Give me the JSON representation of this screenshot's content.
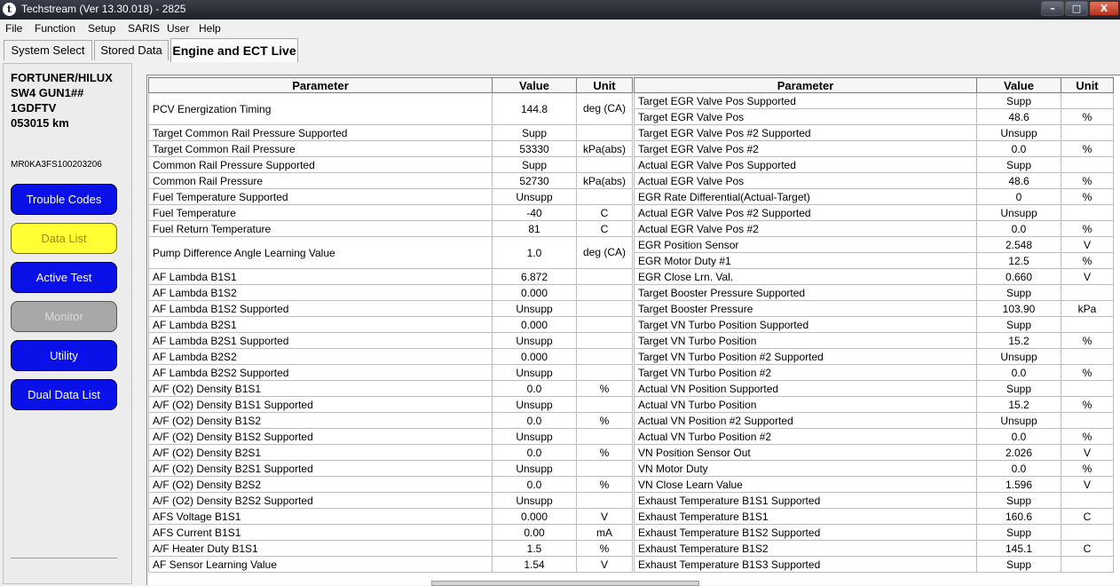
{
  "window": {
    "title": "Techstream (Ver 13.30.018) - 2825",
    "icon_name": "techstream-app-icon",
    "controls": {
      "minimize": "–",
      "maximize": "□",
      "close": "X"
    }
  },
  "menu": [
    "File",
    "Function",
    "Setup",
    "SARIS",
    "User",
    "Help"
  ],
  "tabs": [
    {
      "label": "System Select",
      "active": false
    },
    {
      "label": "Stored Data",
      "active": false
    },
    {
      "label": "Engine and ECT Live",
      "active": true
    }
  ],
  "vehicle": {
    "model_line1": "FORTUNER/HILUX",
    "model_line2": "SW4 GUN1##",
    "engine": "1GDFTV",
    "odometer": "053015 km",
    "vin": "MR0KA3FS100203206"
  },
  "nav_buttons": [
    {
      "label": "Trouble Codes",
      "state": "normal"
    },
    {
      "label": "Data List",
      "state": "selected"
    },
    {
      "label": "Active Test",
      "state": "normal"
    },
    {
      "label": "Monitor",
      "state": "disabled"
    },
    {
      "label": "Utility",
      "state": "normal"
    },
    {
      "label": "Dual Data List",
      "state": "normal"
    }
  ],
  "colors": {
    "nav_blue": "#0a10e8",
    "nav_selected": "#ffff33",
    "nav_disabled": "#a8a8a8"
  },
  "table": {
    "headers": [
      "Parameter",
      "Value",
      "Unit"
    ],
    "left_rows": [
      {
        "p": "PCV Energization Timing",
        "v": "144.8",
        "u": "deg (CA)",
        "tall": true
      },
      {
        "p": "Target Common Rail Pressure Supported",
        "v": "Supp",
        "u": ""
      },
      {
        "p": "Target Common Rail Pressure",
        "v": "53330",
        "u": "kPa(abs)"
      },
      {
        "p": "Common Rail Pressure Supported",
        "v": "Supp",
        "u": ""
      },
      {
        "p": "Common Rail Pressure",
        "v": "52730",
        "u": "kPa(abs)"
      },
      {
        "p": "Fuel Temperature Supported",
        "v": "Unsupp",
        "u": ""
      },
      {
        "p": "Fuel Temperature",
        "v": "-40",
        "u": "C"
      },
      {
        "p": "Fuel Return Temperature",
        "v": "81",
        "u": "C"
      },
      {
        "p": "Pump Difference Angle Learning Value",
        "v": "1.0",
        "u": "deg (CA)",
        "tall": true
      },
      {
        "p": "AF Lambda B1S1",
        "v": "6.872",
        "u": ""
      },
      {
        "p": "AF Lambda B1S2",
        "v": "0.000",
        "u": ""
      },
      {
        "p": "AF Lambda B1S2 Supported",
        "v": "Unsupp",
        "u": ""
      },
      {
        "p": "AF Lambda B2S1",
        "v": "0.000",
        "u": ""
      },
      {
        "p": "AF Lambda B2S1 Supported",
        "v": "Unsupp",
        "u": ""
      },
      {
        "p": "AF Lambda B2S2",
        "v": "0.000",
        "u": ""
      },
      {
        "p": "AF Lambda B2S2 Supported",
        "v": "Unsupp",
        "u": ""
      },
      {
        "p": "A/F (O2) Density B1S1",
        "v": "0.0",
        "u": "%"
      },
      {
        "p": "A/F (O2) Density B1S1 Supported",
        "v": "Unsupp",
        "u": ""
      },
      {
        "p": "A/F (O2) Density B1S2",
        "v": "0.0",
        "u": "%"
      },
      {
        "p": "A/F (O2) Density B1S2 Supported",
        "v": "Unsupp",
        "u": ""
      },
      {
        "p": "A/F (O2) Density B2S1",
        "v": "0.0",
        "u": "%"
      },
      {
        "p": "A/F (O2) Density B2S1 Supported",
        "v": "Unsupp",
        "u": ""
      },
      {
        "p": "A/F (O2) Density B2S2",
        "v": "0.0",
        "u": "%"
      },
      {
        "p": "A/F (O2) Density B2S2 Supported",
        "v": "Unsupp",
        "u": ""
      },
      {
        "p": "AFS Voltage B1S1",
        "v": "0.000",
        "u": "V"
      },
      {
        "p": "AFS Current B1S1",
        "v": "0.00",
        "u": "mA"
      },
      {
        "p": "A/F Heater Duty B1S1",
        "v": "1.5",
        "u": "%"
      },
      {
        "p": "AF Sensor Learning Value",
        "v": "1.54",
        "u": "V"
      }
    ],
    "right_rows": [
      {
        "p": "Target EGR Valve Pos Supported",
        "v": "Supp",
        "u": ""
      },
      {
        "p": "Target EGR Valve Pos",
        "v": "48.6",
        "u": "%"
      },
      {
        "p": "Target EGR Valve Pos #2 Supported",
        "v": "Unsupp",
        "u": ""
      },
      {
        "p": "Target EGR Valve Pos #2",
        "v": "0.0",
        "u": "%"
      },
      {
        "p": "Actual EGR Valve Pos Supported",
        "v": "Supp",
        "u": ""
      },
      {
        "p": "Actual EGR Valve Pos",
        "v": "48.6",
        "u": "%"
      },
      {
        "p": "EGR Rate Differential(Actual-Target)",
        "v": "0",
        "u": "%"
      },
      {
        "p": "Actual EGR Valve Pos #2 Supported",
        "v": "Unsupp",
        "u": ""
      },
      {
        "p": "Actual EGR Valve Pos #2",
        "v": "0.0",
        "u": "%"
      },
      {
        "p": "EGR Position Sensor",
        "v": "2.548",
        "u": "V"
      },
      {
        "p": "EGR Motor Duty #1",
        "v": "12.5",
        "u": "%"
      },
      {
        "p": "EGR Close Lrn. Val.",
        "v": "0.660",
        "u": "V"
      },
      {
        "p": "Target Booster Pressure Supported",
        "v": "Supp",
        "u": ""
      },
      {
        "p": "Target Booster Pressure",
        "v": "103.90",
        "u": "kPa"
      },
      {
        "p": "Target VN Turbo Position Supported",
        "v": "Supp",
        "u": ""
      },
      {
        "p": "Target VN Turbo Position",
        "v": "15.2",
        "u": "%"
      },
      {
        "p": "Target VN Turbo Position #2 Supported",
        "v": "Unsupp",
        "u": ""
      },
      {
        "p": "Target VN Turbo Position #2",
        "v": "0.0",
        "u": "%"
      },
      {
        "p": "Actual VN Position Supported",
        "v": "Supp",
        "u": ""
      },
      {
        "p": "Actual VN Turbo Position",
        "v": "15.2",
        "u": "%"
      },
      {
        "p": "Actual VN Position #2 Supported",
        "v": "Unsupp",
        "u": ""
      },
      {
        "p": "Actual VN Turbo Position #2",
        "v": "0.0",
        "u": "%"
      },
      {
        "p": "VN Position Sensor Out",
        "v": "2.026",
        "u": "V"
      },
      {
        "p": "VN Motor Duty",
        "v": "0.0",
        "u": "%"
      },
      {
        "p": "VN Close Learn Value",
        "v": "1.596",
        "u": "V"
      },
      {
        "p": "Exhaust Temperature B1S1 Supported",
        "v": "Supp",
        "u": ""
      },
      {
        "p": "Exhaust Temperature B1S1",
        "v": "160.6",
        "u": "C"
      },
      {
        "p": "Exhaust Temperature B1S2 Supported",
        "v": "Supp",
        "u": ""
      },
      {
        "p": "Exhaust Temperature B1S2",
        "v": "145.1",
        "u": "C"
      },
      {
        "p": "Exhaust Temperature B1S3 Supported",
        "v": "Supp",
        "u": ""
      }
    ]
  }
}
